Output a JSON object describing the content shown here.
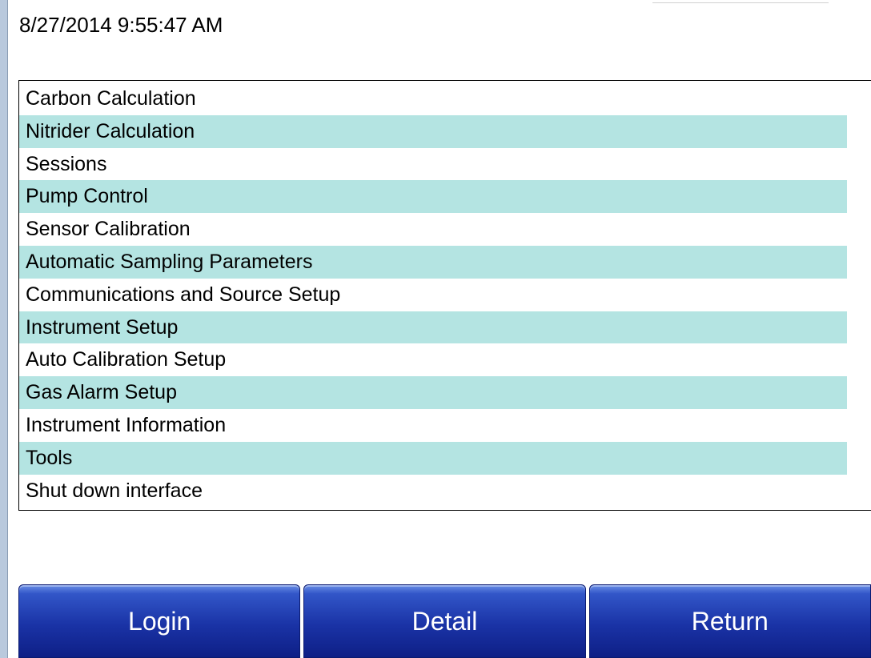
{
  "header": {
    "timestamp": "8/27/2014 9:55:47 AM"
  },
  "menu": {
    "items": [
      {
        "label": "Carbon Calculation"
      },
      {
        "label": "Nitrider Calculation"
      },
      {
        "label": "Sessions"
      },
      {
        "label": "Pump Control"
      },
      {
        "label": "Sensor Calibration"
      },
      {
        "label": "Automatic Sampling Parameters"
      },
      {
        "label": "Communications and Source Setup"
      },
      {
        "label": "Instrument Setup"
      },
      {
        "label": "Auto Calibration Setup"
      },
      {
        "label": "Gas Alarm Setup"
      },
      {
        "label": "Instrument Information"
      },
      {
        "label": "Tools"
      },
      {
        "label": "Shut down interface"
      }
    ],
    "alt_row_color": "#b4e4e2"
  },
  "buttons": {
    "login_label": "Login",
    "detail_label": "Detail",
    "return_label": "Return",
    "color": "#1a33a6"
  }
}
